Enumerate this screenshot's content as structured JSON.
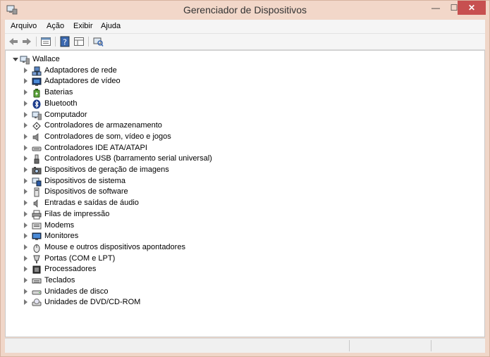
{
  "window": {
    "title": "Gerenciador de Dispositivos",
    "minimize": "—",
    "maximize": "☐",
    "close": "✕"
  },
  "menu": [
    "Arquivo",
    "Ação",
    "Exibir",
    "Ajuda"
  ],
  "toolbar": {
    "buttons": [
      {
        "name": "back-arrow-icon"
      },
      {
        "name": "forward-arrow-icon"
      },
      {
        "name": "properties-icon"
      },
      {
        "name": "help-icon"
      },
      {
        "name": "view-icon"
      },
      {
        "name": "scan-hardware-icon"
      }
    ]
  },
  "tree": {
    "root": {
      "label": "Wallace",
      "icon": "computer-icon"
    },
    "items": [
      {
        "label": "Adaptadores de rede",
        "icon": "network-adapter-icon"
      },
      {
        "label": "Adaptadores de vídeo",
        "icon": "display-adapter-icon"
      },
      {
        "label": "Baterias",
        "icon": "battery-icon"
      },
      {
        "label": "Bluetooth",
        "icon": "bluetooth-icon"
      },
      {
        "label": "Computador",
        "icon": "computer-icon"
      },
      {
        "label": "Controladores de armazenamento",
        "icon": "storage-controller-icon"
      },
      {
        "label": "Controladores de som, vídeo e jogos",
        "icon": "speaker-icon"
      },
      {
        "label": "Controladores IDE ATA/ATAPI",
        "icon": "ide-controller-icon"
      },
      {
        "label": "Controladores USB (barramento serial universal)",
        "icon": "usb-icon"
      },
      {
        "label": "Dispositivos de geração de imagens",
        "icon": "camera-icon"
      },
      {
        "label": "Dispositivos de sistema",
        "icon": "system-device-icon"
      },
      {
        "label": "Dispositivos de software",
        "icon": "software-device-icon"
      },
      {
        "label": "Entradas e saídas de áudio",
        "icon": "audio-io-icon"
      },
      {
        "label": "Filas de impressão",
        "icon": "printer-icon"
      },
      {
        "label": "Modems",
        "icon": "modem-icon"
      },
      {
        "label": "Monitores",
        "icon": "monitor-icon"
      },
      {
        "label": "Mouse e outros dispositivos apontadores",
        "icon": "mouse-icon"
      },
      {
        "label": "Portas (COM e LPT)",
        "icon": "port-icon"
      },
      {
        "label": "Processadores",
        "icon": "processor-icon"
      },
      {
        "label": "Teclados",
        "icon": "keyboard-icon"
      },
      {
        "label": "Unidades de disco",
        "icon": "disk-drive-icon"
      },
      {
        "label": "Unidades de DVD/CD-ROM",
        "icon": "dvd-drive-icon"
      }
    ]
  },
  "colors": {
    "titlebar": "#f2d7c9",
    "close": "#c75050",
    "content": "#ffffff"
  }
}
